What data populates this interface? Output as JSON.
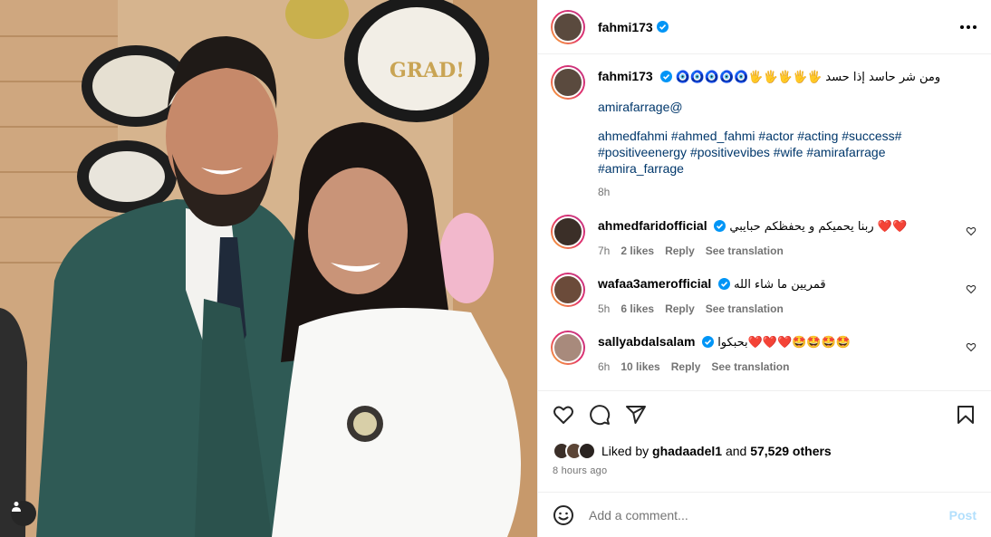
{
  "post": {
    "username": "fahmi173",
    "caption": {
      "username": "fahmi173",
      "emoji_line": "🧿🧿🧿🧿🧿🖐🖐🖐🖐🖐",
      "arabic_text": "ومن شر حاسد إذا حسد",
      "mention": "amirafarrage@",
      "hashtags_line1": "ahmedfahmi #ahmed_fahmi #actor #acting #success#",
      "hashtags_line2": "#positiveenergy #positivevibes #wife #amirafarrage",
      "hashtags_line3": "#amira_farrage",
      "time": "8h"
    },
    "comments": [
      {
        "username": "ahmedfaridofficial",
        "text": "ربنا يحميكم و يحفظكم حبايبي ❤️❤️",
        "time": "7h",
        "likes": "2 likes",
        "reply": "Reply",
        "translate": "See translation",
        "avatar_color": "#3b2f28"
      },
      {
        "username": "wafaa3amerofficial",
        "text": "قمريين ما شاء الله",
        "time": "5h",
        "likes": "6 likes",
        "reply": "Reply",
        "translate": "See translation",
        "avatar_color": "#6b4b3a"
      },
      {
        "username": "sallyabdalsalam",
        "text": "بحبكوا❤️❤️❤️🤩🤩🤩🤩",
        "time": "6h",
        "likes": "10 likes",
        "reply": "Reply",
        "translate": "See translation",
        "avatar_color": "#a88a7c"
      }
    ],
    "liked_by_prefix": "Liked by",
    "liked_by_user": "ghadaadel1",
    "liked_by_and": "and",
    "liked_by_count": "57,529 others",
    "posted_ago": "8 hours ago",
    "add_comment_placeholder": "Add a comment...",
    "post_label": "Post"
  },
  "colors": {
    "verified": "#0095f6",
    "link": "#00376b",
    "muted": "#737373",
    "post_disabled": "#b2dffc"
  },
  "icons": [
    "heart-icon",
    "comment-icon",
    "share-icon",
    "bookmark-icon",
    "emoji-icon",
    "more-icon",
    "verified-icon",
    "user-tag-icon"
  ]
}
